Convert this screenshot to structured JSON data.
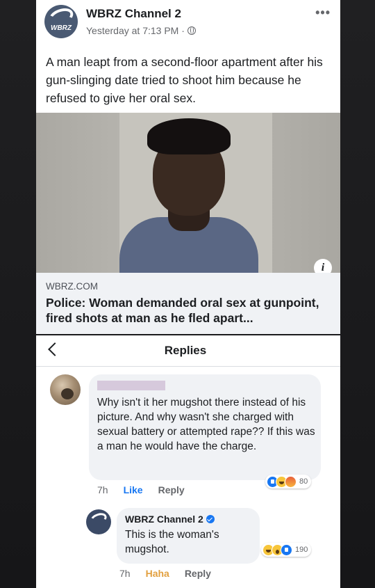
{
  "post": {
    "page_name": "WBRZ Channel 2",
    "avatar_text": "WBRZ",
    "timestamp": "Yesterday at 7:13 PM ·",
    "text": "A man leapt from a second-floor apartment after his gun-slinging date tried to shoot him because he refused to give her oral sex.",
    "link_domain": "WBRZ.COM",
    "link_title": "Police: Woman demanded oral sex at gunpoint, fired shots at man as he fled apart...",
    "info_glyph": "i"
  },
  "replies": {
    "title": "Replies",
    "comment": {
      "text": "Why isn't it her mugshot there instead of his picture. And why wasn't she charged with sexual battery or attempted rape?? If this was a man he would have the charge.",
      "time": "7h",
      "like_label": "Like",
      "reply_label": "Reply",
      "reaction_count": "80"
    },
    "reply": {
      "author": "WBRZ Channel 2",
      "text": "This is the woman's mugshot.",
      "time": "7h",
      "reaction_label": "Haha",
      "reply_label": "Reply",
      "reaction_count": "190"
    }
  },
  "colors": {
    "accent": "#1877f2",
    "haha": "#e2a03f",
    "bubble": "#f0f2f5"
  },
  "icons": [
    "globe-icon",
    "more-icon",
    "info-icon",
    "back-icon",
    "verified-icon",
    "like-reaction-icon",
    "haha-reaction-icon",
    "wow-reaction-icon",
    "angry-reaction-icon"
  ]
}
